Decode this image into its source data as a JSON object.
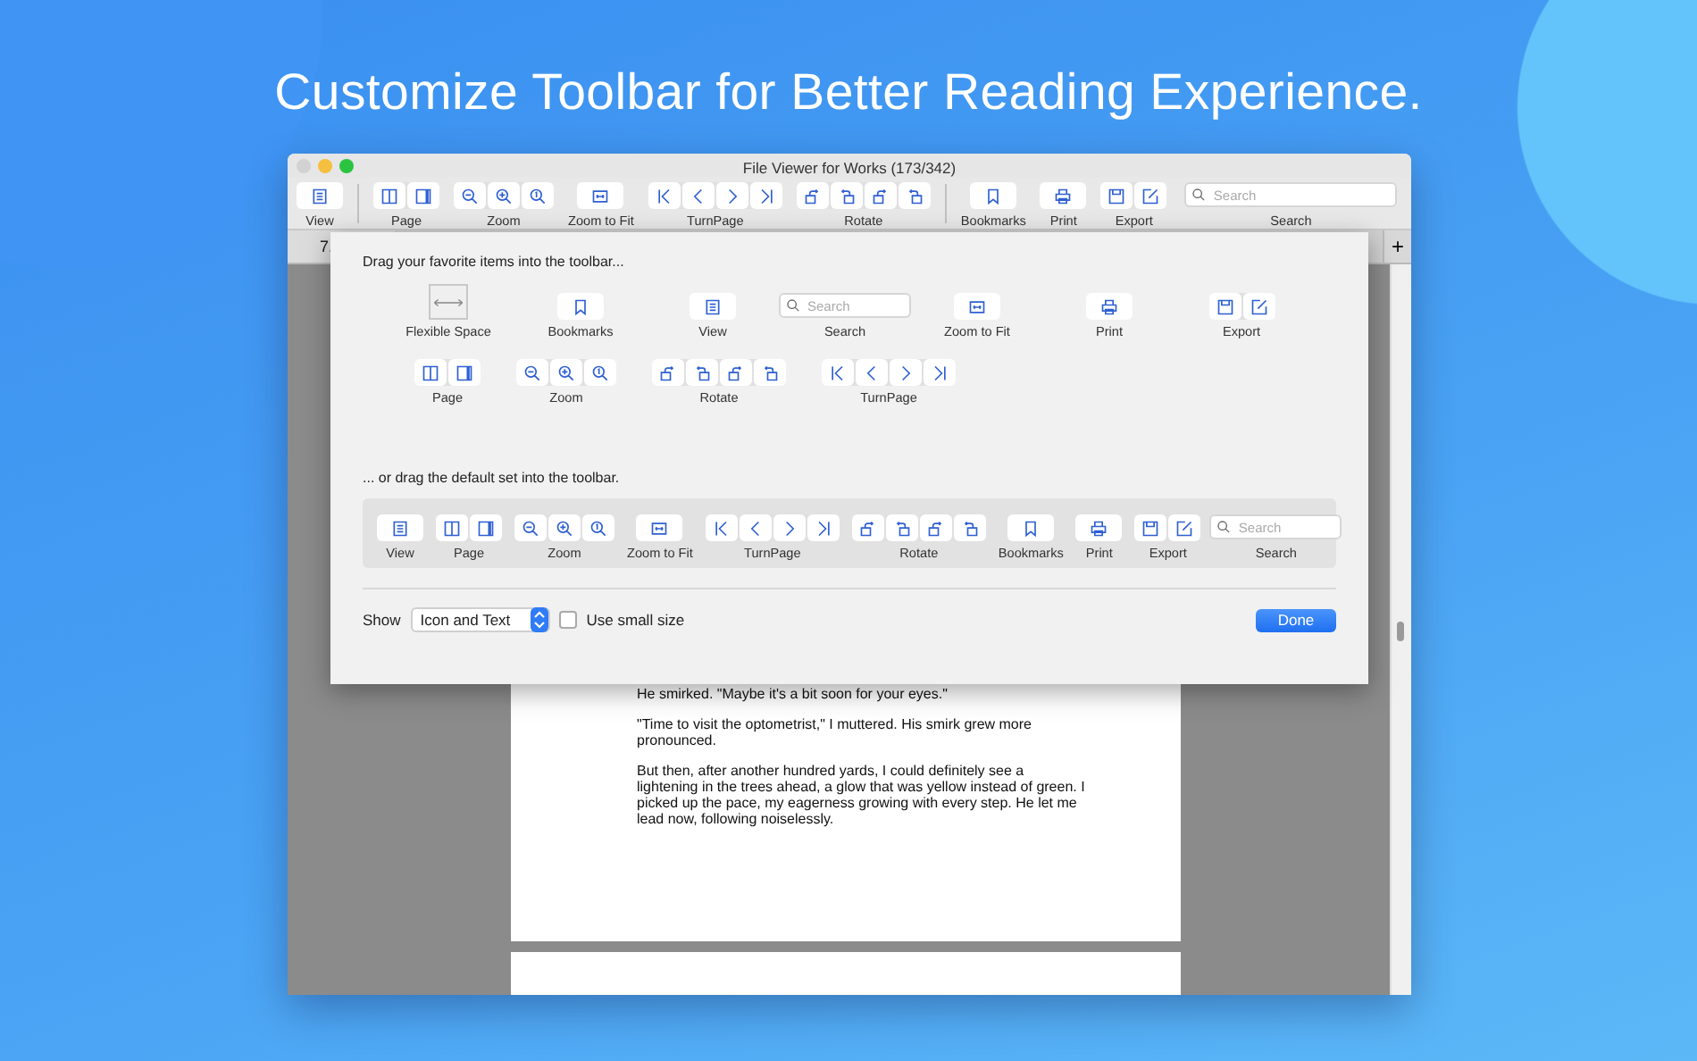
{
  "headline": "Customize Toolbar for Better Reading Experience.",
  "window": {
    "title": "File Viewer for Works (173/342)"
  },
  "toolbar": [
    {
      "kind": "view",
      "label": "View"
    },
    {
      "kind": "separator"
    },
    {
      "kind": "page",
      "label": "Page"
    },
    {
      "kind": "zoom",
      "label": "Zoom"
    },
    {
      "kind": "zoom_to_fit",
      "label": "Zoom to Fit"
    },
    {
      "kind": "turn_page",
      "label": "TurnPage"
    },
    {
      "kind": "rotate",
      "label": "Rotate"
    },
    {
      "kind": "separator"
    },
    {
      "kind": "bookmarks",
      "label": "Bookmarks"
    },
    {
      "kind": "print",
      "label": "Print"
    },
    {
      "kind": "export",
      "label": "Export"
    },
    {
      "kind": "search",
      "label": "Search",
      "placeholder": "Search"
    }
  ],
  "tab_bar": {
    "tabs": [
      {
        "label": "7.",
        "selected": true
      }
    ],
    "add_label": "+"
  },
  "document": {
    "paragraphs": [
      "He smirked. \"Maybe it's a bit soon for your eyes.\"",
      "\"Time to visit the optometrist,\" I muttered. His smirk grew more pronounced.",
      "But then, after another hundred yards, I could definitely see a lightening in the trees ahead, a glow that was yellow instead of green. I picked up the pace, my eagerness growing with every step. He let me lead now, following noiselessly."
    ]
  },
  "customize_sheet": {
    "palette_heading": "Drag your favorite items into the toolbar...",
    "palette_rows": [
      {
        "items": [
          {
            "kind": "flexible_space",
            "label": "Flexible Space"
          },
          {
            "kind": "bookmarks",
            "label": "Bookmarks"
          },
          {
            "kind": "view",
            "label": "View"
          },
          {
            "kind": "search",
            "label": "Search",
            "placeholder": "Search"
          },
          {
            "kind": "zoom_to_fit",
            "label": "Zoom to Fit"
          },
          {
            "kind": "print",
            "label": "Print"
          },
          {
            "kind": "export",
            "label": "Export"
          }
        ]
      },
      {
        "items": [
          {
            "kind": "page",
            "label": "Page"
          },
          {
            "kind": "zoom",
            "label": "Zoom"
          },
          {
            "kind": "rotate",
            "label": "Rotate"
          },
          {
            "kind": "turn_page",
            "label": "TurnPage"
          }
        ]
      }
    ],
    "default_heading": "... or drag the default set into the toolbar.",
    "default_set": [
      {
        "kind": "view",
        "label": "View"
      },
      {
        "kind": "page",
        "label": "Page"
      },
      {
        "kind": "zoom",
        "label": "Zoom"
      },
      {
        "kind": "zoom_to_fit",
        "label": "Zoom to Fit"
      },
      {
        "kind": "turn_page",
        "label": "TurnPage"
      },
      {
        "kind": "rotate",
        "label": "Rotate"
      },
      {
        "kind": "bookmarks",
        "label": "Bookmarks"
      },
      {
        "kind": "print",
        "label": "Print"
      },
      {
        "kind": "export",
        "label": "Export"
      },
      {
        "kind": "search",
        "label": "Search",
        "placeholder": "Search"
      }
    ],
    "show": {
      "label": "Show",
      "value": "Icon and Text"
    },
    "small_size": {
      "label": "Use small size",
      "checked": false
    },
    "done_button": "Done"
  }
}
